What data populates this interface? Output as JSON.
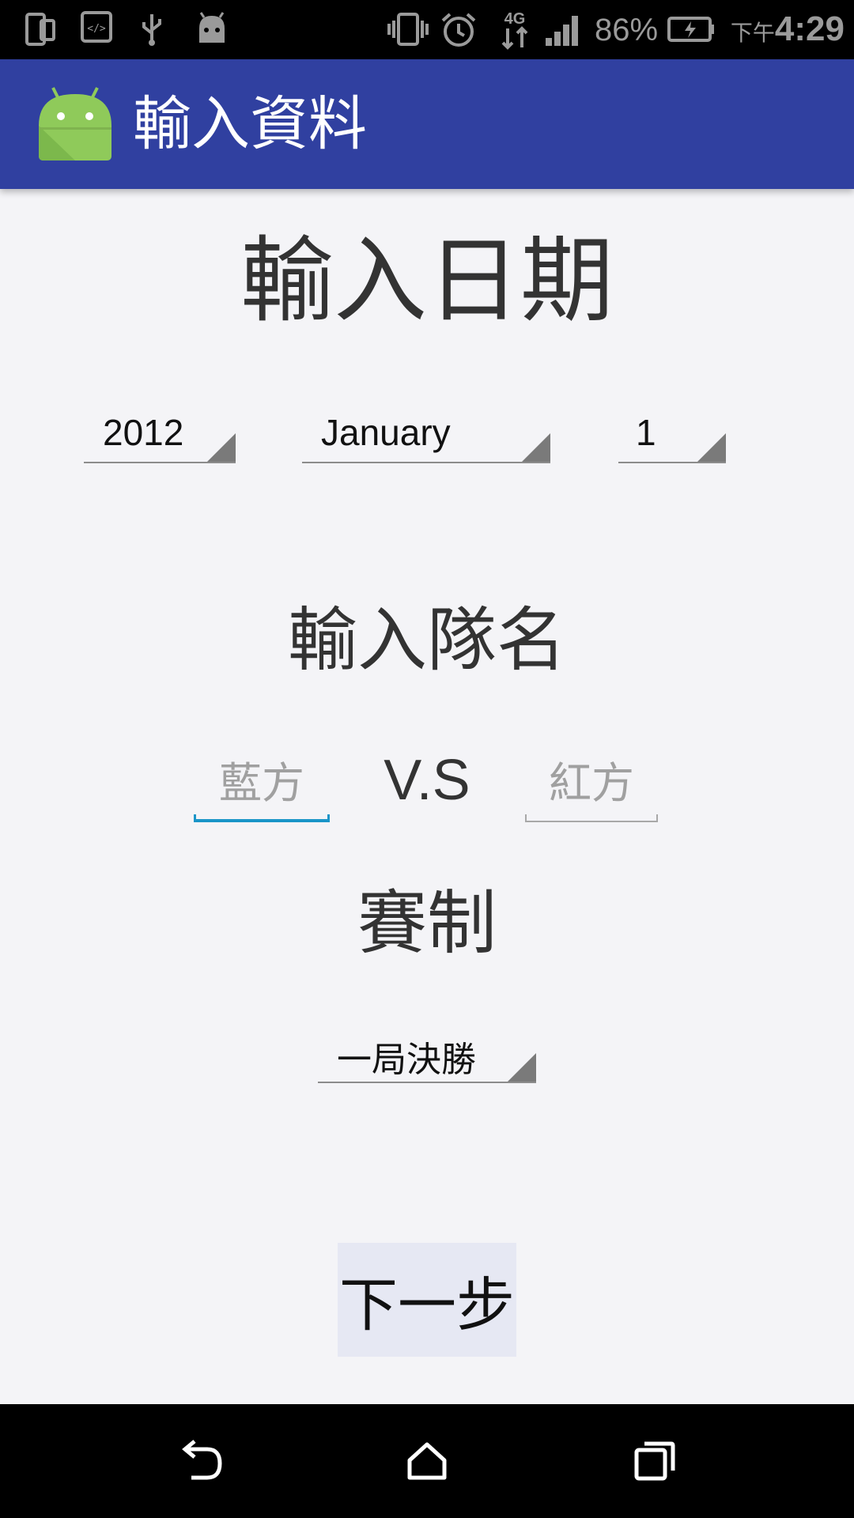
{
  "status_bar": {
    "battery_percent": "86%",
    "time_ampm": "下午",
    "time": "4:29",
    "network": "4G"
  },
  "app_bar": {
    "title": "輸入資料",
    "logo_icon": "android-robot-icon",
    "bar_color": "#3040a0"
  },
  "date_section": {
    "heading": "輸入日期",
    "year": "2012",
    "month": "January",
    "day": "1"
  },
  "team_section": {
    "heading": "輸入隊名",
    "blue_placeholder": "藍方",
    "vs_label": "V.S",
    "red_placeholder": "紅方",
    "focus_color": "#1a95c8"
  },
  "format_section": {
    "heading": "賽制",
    "selected": "一局決勝"
  },
  "next_button": {
    "label": "下一步"
  }
}
